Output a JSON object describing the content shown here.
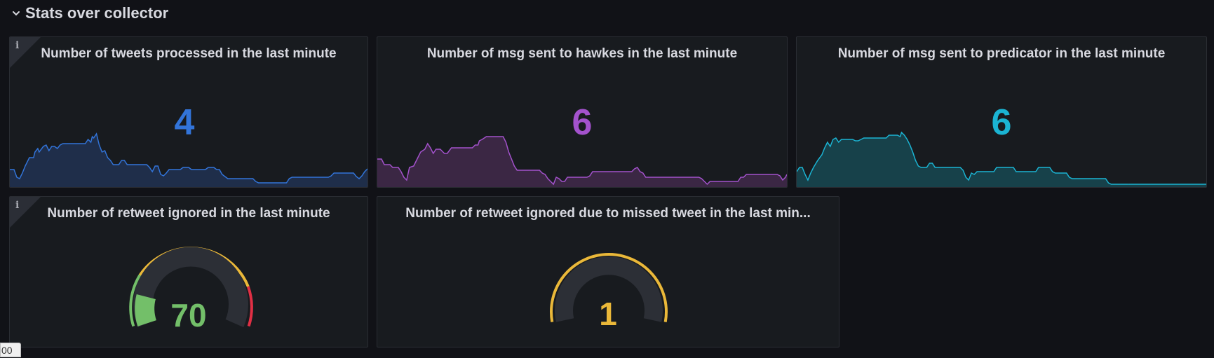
{
  "row": {
    "title": "Stats over collector",
    "icon": "chevron-down-icon"
  },
  "panels": {
    "tweets": {
      "title": "Number of tweets processed in the last minute",
      "value": "4",
      "color": "#3274d9",
      "fill": "#1f2e4a",
      "info_icon": "i"
    },
    "hawkes": {
      "title": "Number of msg sent to hawkes in the last minute",
      "value": "6",
      "color": "#a352cc",
      "fill": "#3b2744"
    },
    "predicator": {
      "title": "Number of msg sent to predicator in the last minute",
      "value": "6",
      "color": "#1bb4d3",
      "fill": "#17414a"
    },
    "retweet_ignored": {
      "title": "Number of retweet ignored in the last minute",
      "value": "70",
      "color": "#73bf69",
      "info_icon": "i",
      "thresholds": [
        "#73bf69",
        "#f2cc0c",
        "#e02f44"
      ]
    },
    "retweet_missed": {
      "title": "Number of retweet ignored due to missed tweet in the last min...",
      "value": "1",
      "color": "#eab839"
    }
  },
  "corner_tag": "00"
}
